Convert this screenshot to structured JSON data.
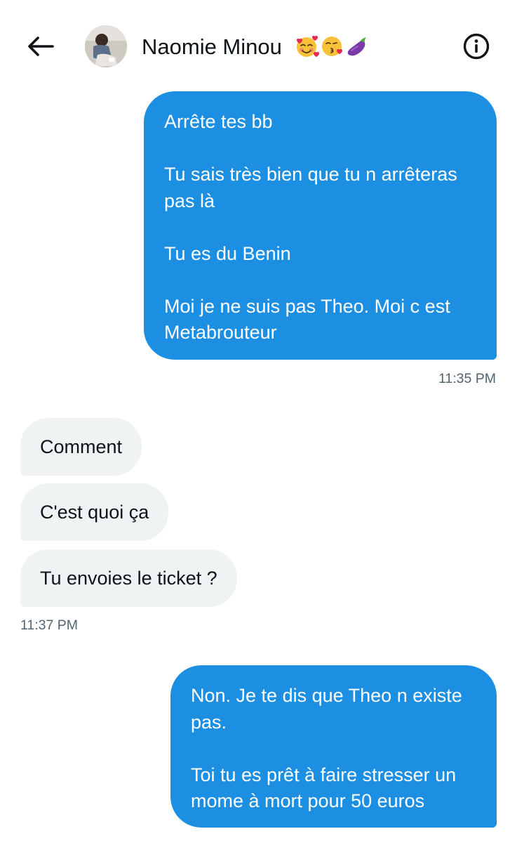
{
  "header": {
    "contact_name": "Naomie Minou",
    "contact_emojis": [
      "smiling-face-with-hearts",
      "face-blowing-kiss",
      "eggplant"
    ],
    "back_icon": "arrow-left-icon",
    "info_icon": "info-icon"
  },
  "messages": [
    {
      "direction": "sent",
      "text": "Arrête tes bb\n\nTu sais très bien que tu n arrêteras pas là\n\nTu es du Benin\n\nMoi je ne suis pas Theo. Moi c est Metabrouteur"
    },
    {
      "direction": "sent",
      "timestamp": "11:35 PM"
    },
    {
      "direction": "received",
      "text": "Comment"
    },
    {
      "direction": "received",
      "text": "C'est quoi ça"
    },
    {
      "direction": "received",
      "text": "Tu envoies le ticket ?"
    },
    {
      "direction": "received",
      "timestamp": "11:37 PM"
    },
    {
      "direction": "sent",
      "text": "Non. Je te dis que Theo n existe pas.\n\nToi tu es prêt à faire stresser un mome à mort pour 50 euros"
    }
  ],
  "colors": {
    "sent_bubble": "#1d8fe3",
    "received_bubble": "#eff3f4",
    "timestamp_text": "#536471",
    "primary_text": "#0f1419"
  }
}
